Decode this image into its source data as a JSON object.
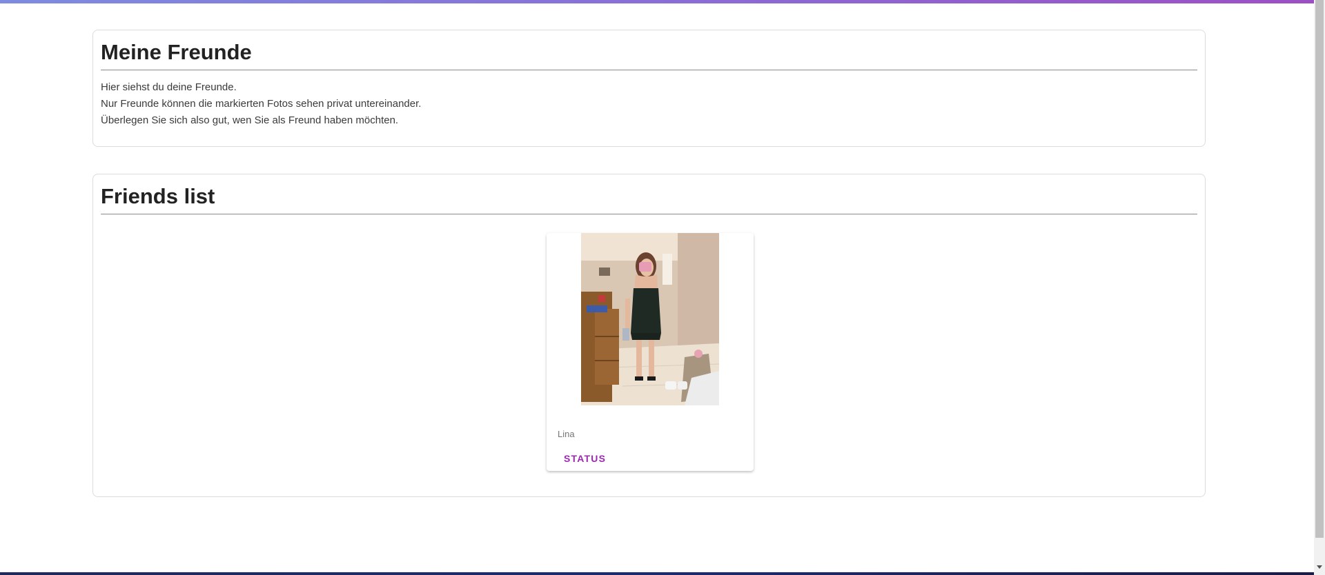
{
  "theme": {
    "accent": "#9c27b0",
    "top_bar_start": "#7e8be0",
    "top_bar_end": "#9c4fc4"
  },
  "intro": {
    "title": "Meine Freunde",
    "lines": [
      "Hier siehst du deine Freunde.",
      "Nur Freunde können die markierten Fotos sehen privat untereinander.",
      "Überlegen Sie sich also gut, wen Sie als Freund haben möchten."
    ]
  },
  "friends": {
    "title": "Friends list",
    "items": [
      {
        "name": "Lina",
        "status_label": "STATUS",
        "photo_icon": "user-photo"
      }
    ]
  }
}
